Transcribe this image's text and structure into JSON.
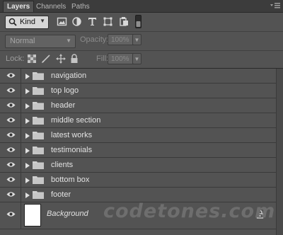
{
  "tabs": [
    {
      "label": "Layers",
      "active": true
    },
    {
      "label": "Channels",
      "active": false
    },
    {
      "label": "Paths",
      "active": false
    }
  ],
  "panel_menu_icon": "panel-menu-icon",
  "filter": {
    "kind_label": "Kind",
    "icons": [
      "pixel-filter-icon",
      "adjustment-filter-icon",
      "type-filter-icon",
      "shape-filter-icon",
      "smart-object-filter-icon",
      "filter-toggle-switch"
    ]
  },
  "blend": {
    "mode": "Normal",
    "opacity_label": "Opacity:",
    "opacity_value": "100%"
  },
  "lock": {
    "label": "Lock:",
    "icons": [
      "lock-transparent-icon",
      "lock-image-icon",
      "lock-position-icon",
      "lock-all-icon"
    ],
    "fill_label": "Fill:",
    "fill_value": "100%"
  },
  "layers": [
    {
      "name": "navigation"
    },
    {
      "name": "top logo"
    },
    {
      "name": "header"
    },
    {
      "name": "middle section"
    },
    {
      "name": "latest works"
    },
    {
      "name": "testimonials"
    },
    {
      "name": "clients"
    },
    {
      "name": "bottom box"
    },
    {
      "name": "footer"
    }
  ],
  "background_layer": {
    "name": "Background",
    "locked": true
  },
  "watermark": "codetones.com",
  "colors": {
    "panel": "#535353",
    "tabbar": "#3c3c3c",
    "thumb": "#ffffff"
  }
}
